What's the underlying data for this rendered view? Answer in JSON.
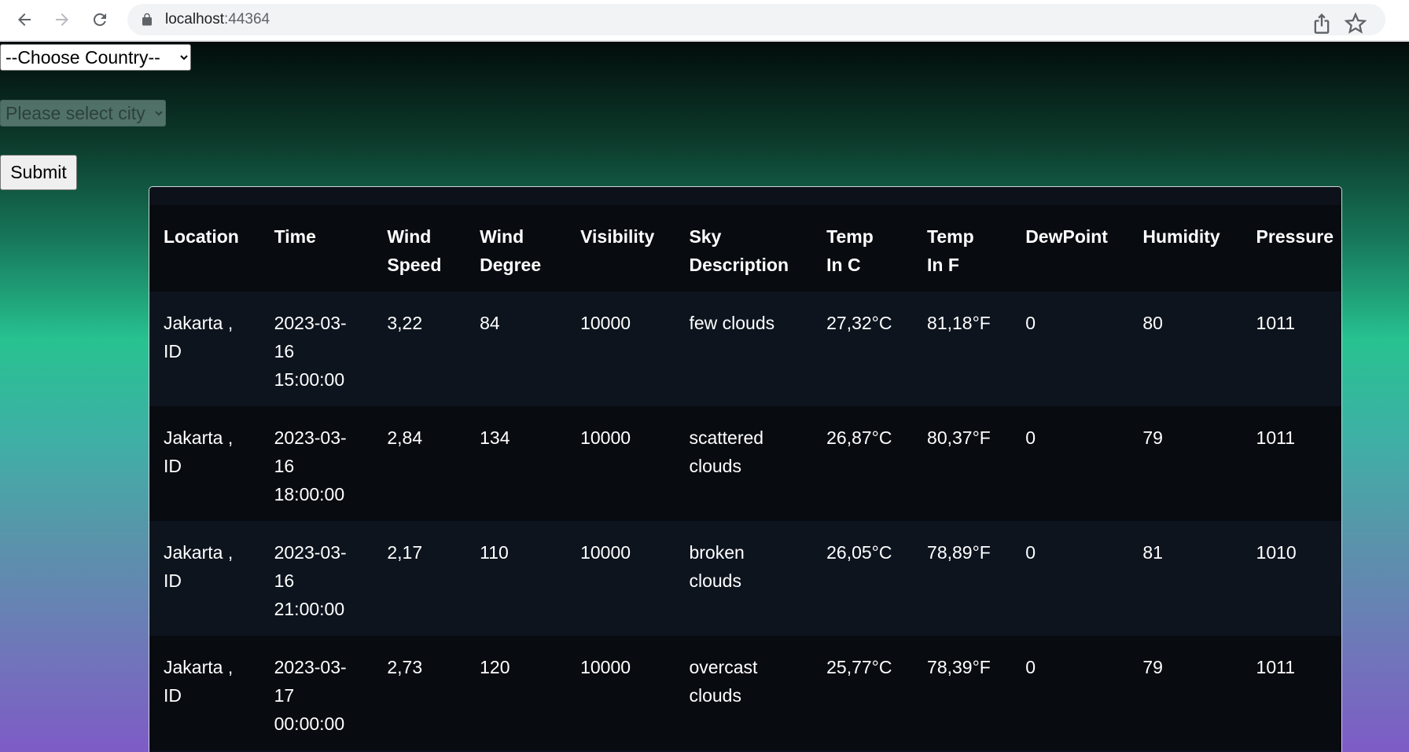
{
  "browser": {
    "url_host": "localhost",
    "url_port": ":44364"
  },
  "form": {
    "country_selected": "--Choose Country--",
    "city_selected": "Please select city",
    "submit_label": "Submit"
  },
  "table": {
    "headers": [
      [
        "Location"
      ],
      [
        "Time"
      ],
      [
        "Wind",
        "Speed"
      ],
      [
        "Wind",
        "Degree"
      ],
      [
        "Visibility"
      ],
      [
        "Sky",
        "Description"
      ],
      [
        "Temp",
        "In C"
      ],
      [
        "Temp",
        "In F"
      ],
      [
        "DewPoint"
      ],
      [
        "Humidity"
      ],
      [
        "Pressure"
      ]
    ],
    "rows": [
      {
        "location": [
          "Jakarta ,",
          "ID"
        ],
        "time": [
          "2023-03-",
          "16",
          "15:00:00"
        ],
        "wind_speed": "3,22",
        "wind_degree": "84",
        "visibility": "10000",
        "sky": [
          "few clouds"
        ],
        "temp_c": "27,32°C",
        "temp_f": "81,18°F",
        "dewpoint": "0",
        "humidity": "80",
        "pressure": "1011"
      },
      {
        "location": [
          "Jakarta ,",
          "ID"
        ],
        "time": [
          "2023-03-",
          "16",
          "18:00:00"
        ],
        "wind_speed": "2,84",
        "wind_degree": "134",
        "visibility": "10000",
        "sky": [
          "scattered",
          "clouds"
        ],
        "temp_c": "26,87°C",
        "temp_f": "80,37°F",
        "dewpoint": "0",
        "humidity": "79",
        "pressure": "1011"
      },
      {
        "location": [
          "Jakarta ,",
          "ID"
        ],
        "time": [
          "2023-03-",
          "16",
          "21:00:00"
        ],
        "wind_speed": "2,17",
        "wind_degree": "110",
        "visibility": "10000",
        "sky": [
          "broken",
          "clouds"
        ],
        "temp_c": "26,05°C",
        "temp_f": "78,89°F",
        "dewpoint": "0",
        "humidity": "81",
        "pressure": "1010"
      },
      {
        "location": [
          "Jakarta ,",
          "ID"
        ],
        "time": [
          "2023-03-",
          "17",
          "00:00:00"
        ],
        "wind_speed": "2,73",
        "wind_degree": "120",
        "visibility": "10000",
        "sky": [
          "overcast",
          "clouds"
        ],
        "temp_c": "25,77°C",
        "temp_f": "78,39°F",
        "dewpoint": "0",
        "humidity": "79",
        "pressure": "1011"
      }
    ]
  },
  "icons": {
    "back": "arrow-left-icon",
    "forward": "arrow-right-icon",
    "reload": "reload-icon",
    "lock": "lock-icon",
    "share": "share-icon",
    "bookmark": "star-icon"
  }
}
